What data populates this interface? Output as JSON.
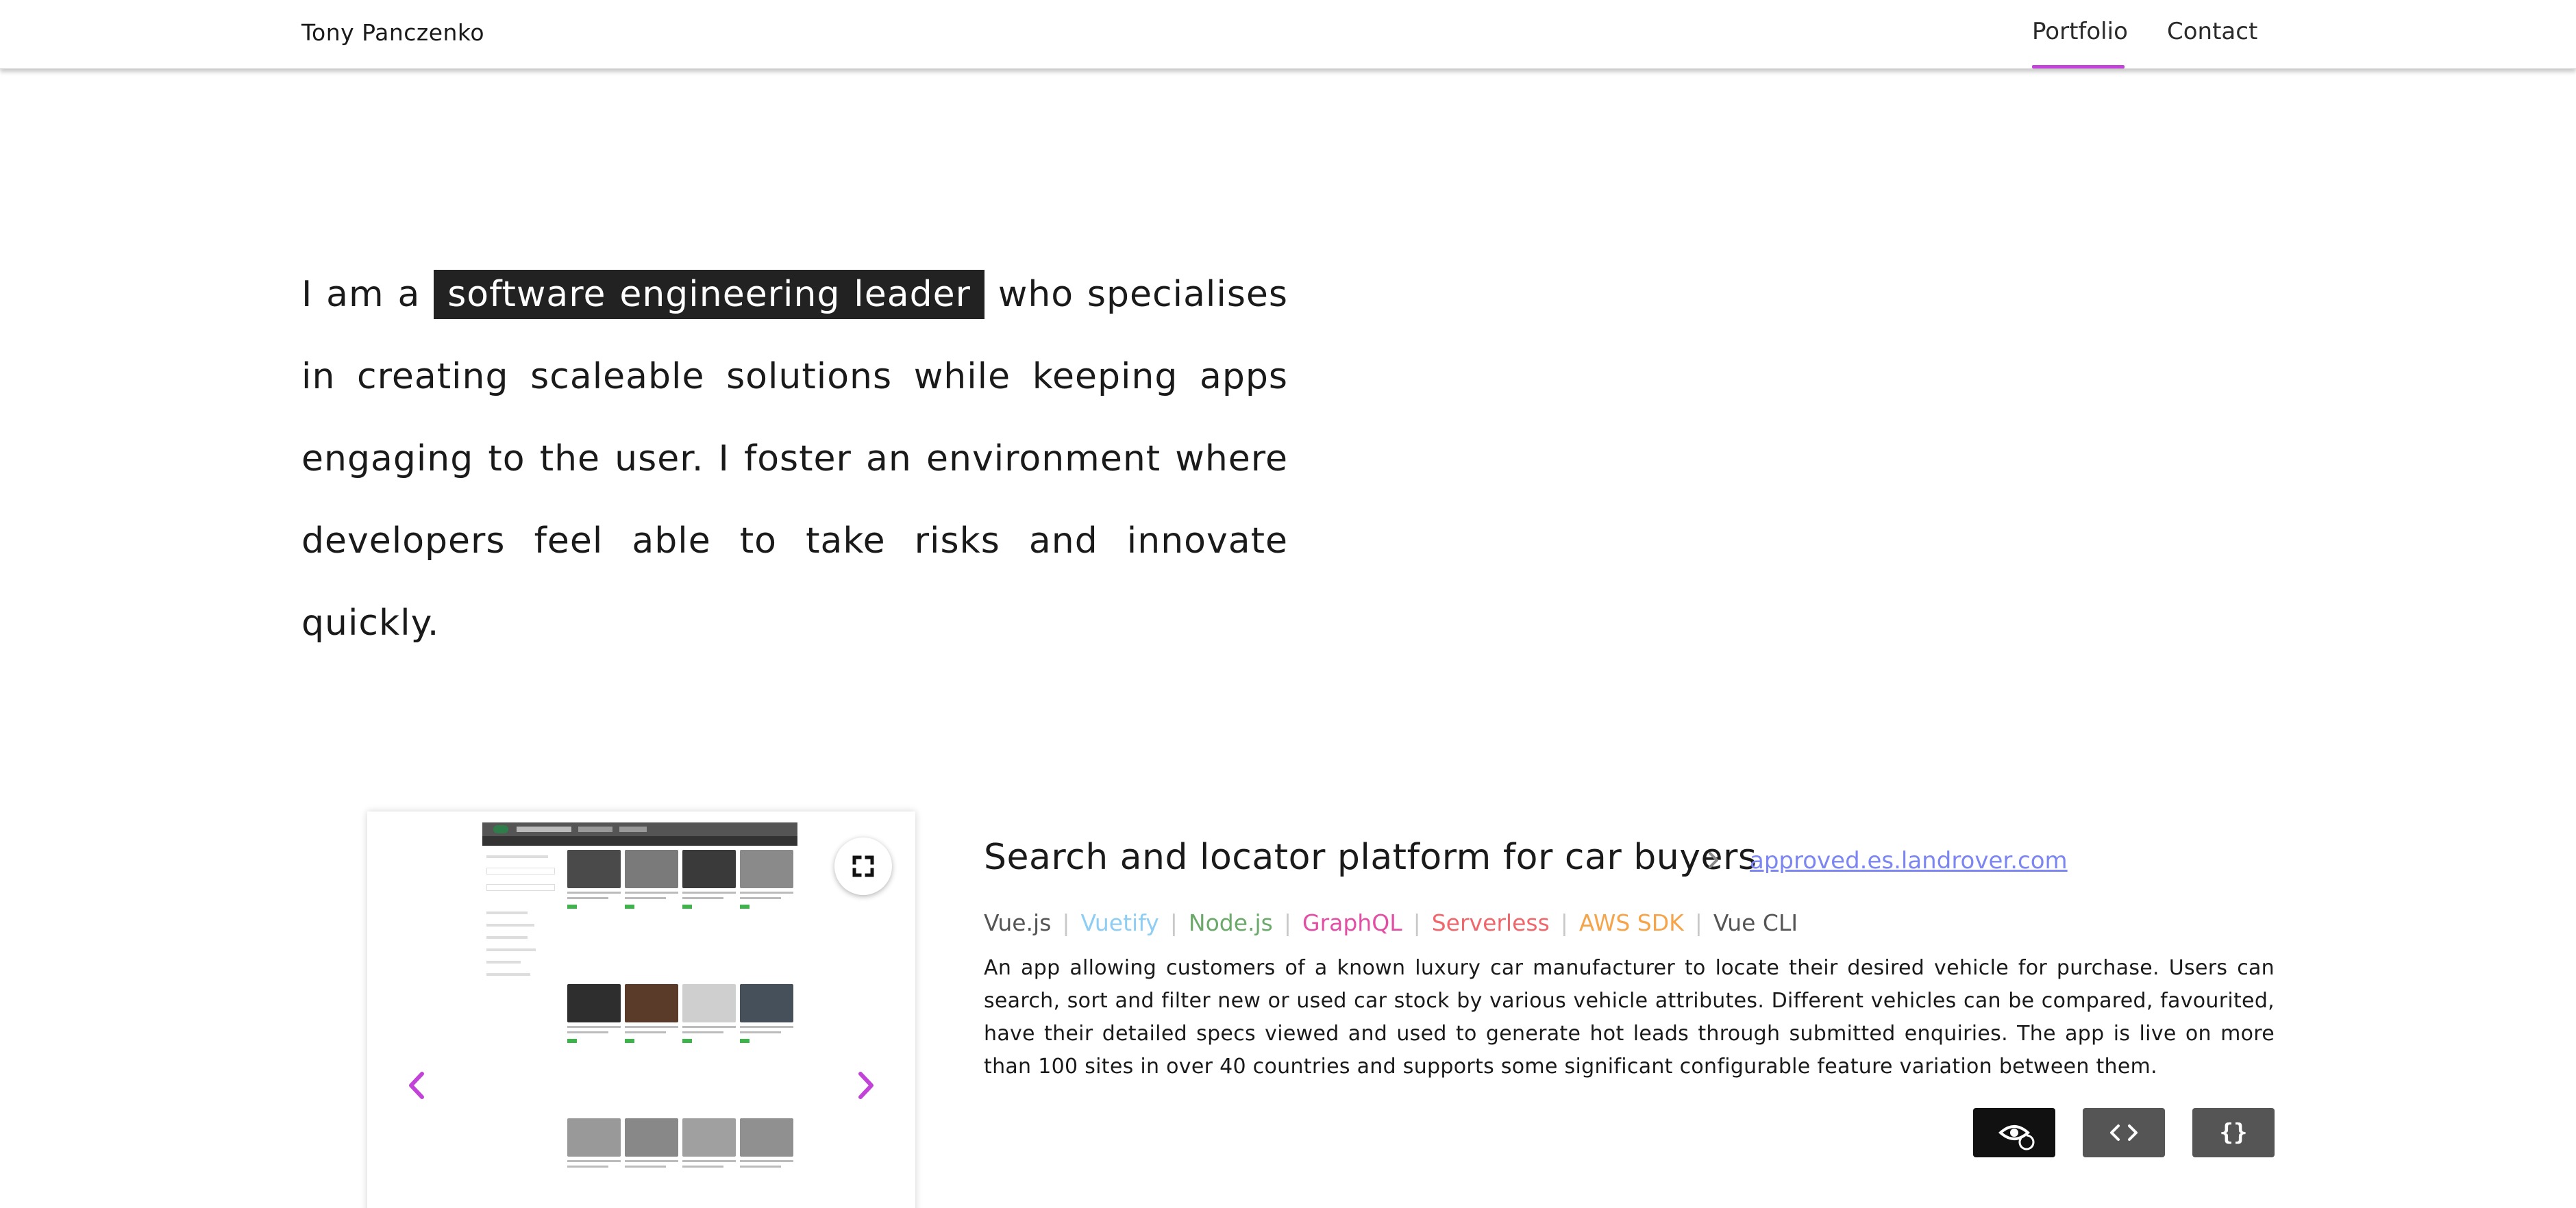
{
  "header": {
    "brand": "Tony Panczenko",
    "nav": [
      {
        "label": "Portfolio",
        "active": true
      },
      {
        "label": "Contact",
        "active": false
      }
    ],
    "active_color": "#c243d8"
  },
  "intro": {
    "prefix": "I am a",
    "highlight": "software engineering leader",
    "rest": "who specialises in creating scaleable solutions while keeping apps engaging to the user. I foster an environment where developers feel able to take risks and innovate quickly."
  },
  "project": {
    "title": "Search and locator platform for car buyers",
    "link_text": "approved.es.landrover.com",
    "tech": [
      {
        "label": "Vue.js",
        "color": "#555555"
      },
      {
        "label": "Vuetify",
        "color": "#8ecdf4"
      },
      {
        "label": "Node.js",
        "color": "#6aa96a"
      },
      {
        "label": "GraphQL",
        "color": "#e34ea5"
      },
      {
        "label": "Serverless",
        "color": "#f0666b"
      },
      {
        "label": "AWS SDK",
        "color": "#f5a449"
      },
      {
        "label": "Vue CLI",
        "color": "#555555"
      }
    ],
    "separator": "|",
    "description": "An app allowing customers of a known luxury car manufacturer to locate their desired vehicle for purchase. Users can search, sort and filter new or used car stock by various vehicle attributes. Different vehicles can be compared, favourited, have their detailed specs viewed and used to generate hot leads through submitted enquiries. The app is live on more than 100 sites in over 40 countries and supports some significant configurable feature variation between them.",
    "buttons": {
      "view_icon": "eye-refresh-icon",
      "code_icon": "code-brackets-icon",
      "json_label": "{}"
    },
    "carousel": {
      "prev_icon": "chevron-left-icon",
      "next_icon": "chevron-right-icon",
      "expand_icon": "fullscreen-icon",
      "arrow_color": "#c243d8"
    }
  }
}
